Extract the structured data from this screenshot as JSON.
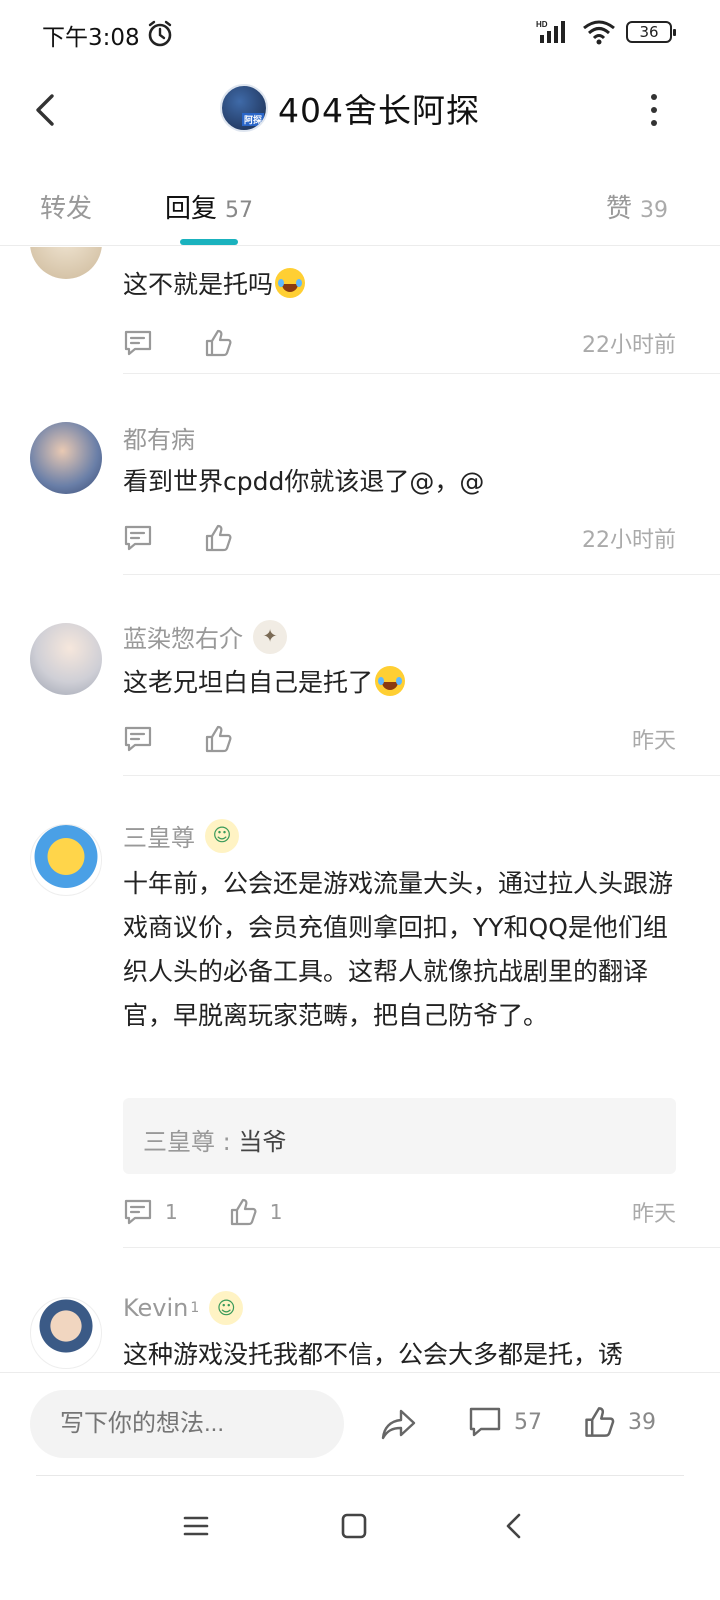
{
  "status": {
    "time": "下午3:08",
    "network": "HD",
    "battery": "36"
  },
  "header": {
    "title": "404舍长阿探",
    "avatar_badge": "阿探"
  },
  "tabs": {
    "forward": "转发",
    "reply": "回复",
    "reply_count": "57",
    "like": "赞",
    "like_count": "39"
  },
  "comments": [
    {
      "name": "",
      "text": "这不就是托吗",
      "emoji": "laugh-cry",
      "time": "22小时前",
      "reply_count": "",
      "like_count": ""
    },
    {
      "name": "都有病",
      "text": "看到世界cpdd你就该退了@，@",
      "time": "22小时前",
      "reply_count": "",
      "like_count": ""
    },
    {
      "name": "蓝染惣右介",
      "text": "这老兄坦白自己是托了",
      "emoji": "laugh-cry",
      "time": "昨天",
      "reply_count": "",
      "like_count": ""
    },
    {
      "name": "三皇尊",
      "text": "十年前，公会还是游戏流量大头，通过拉人头跟游戏商议价，会员充值则拿回扣，YY和QQ是他们组织人头的必备工具。这帮人就像抗战剧里的翻译官，早脱离玩家范畴，把自己防爷了。",
      "time": "昨天",
      "reply_count": "1",
      "like_count": "1",
      "sub_reply": {
        "name": "三皇尊",
        "separator": " : ",
        "text": "当爷"
      }
    },
    {
      "name": "Kevin",
      "name_sup": "1",
      "text": "这种游戏没托我都不信，公会大多都是托，诱"
    }
  ],
  "bottom": {
    "placeholder": "写下你的想法...",
    "comment_count": "57",
    "like_count": "39"
  },
  "colors": {
    "accent": "#1ab2be",
    "muted": "#999999"
  }
}
